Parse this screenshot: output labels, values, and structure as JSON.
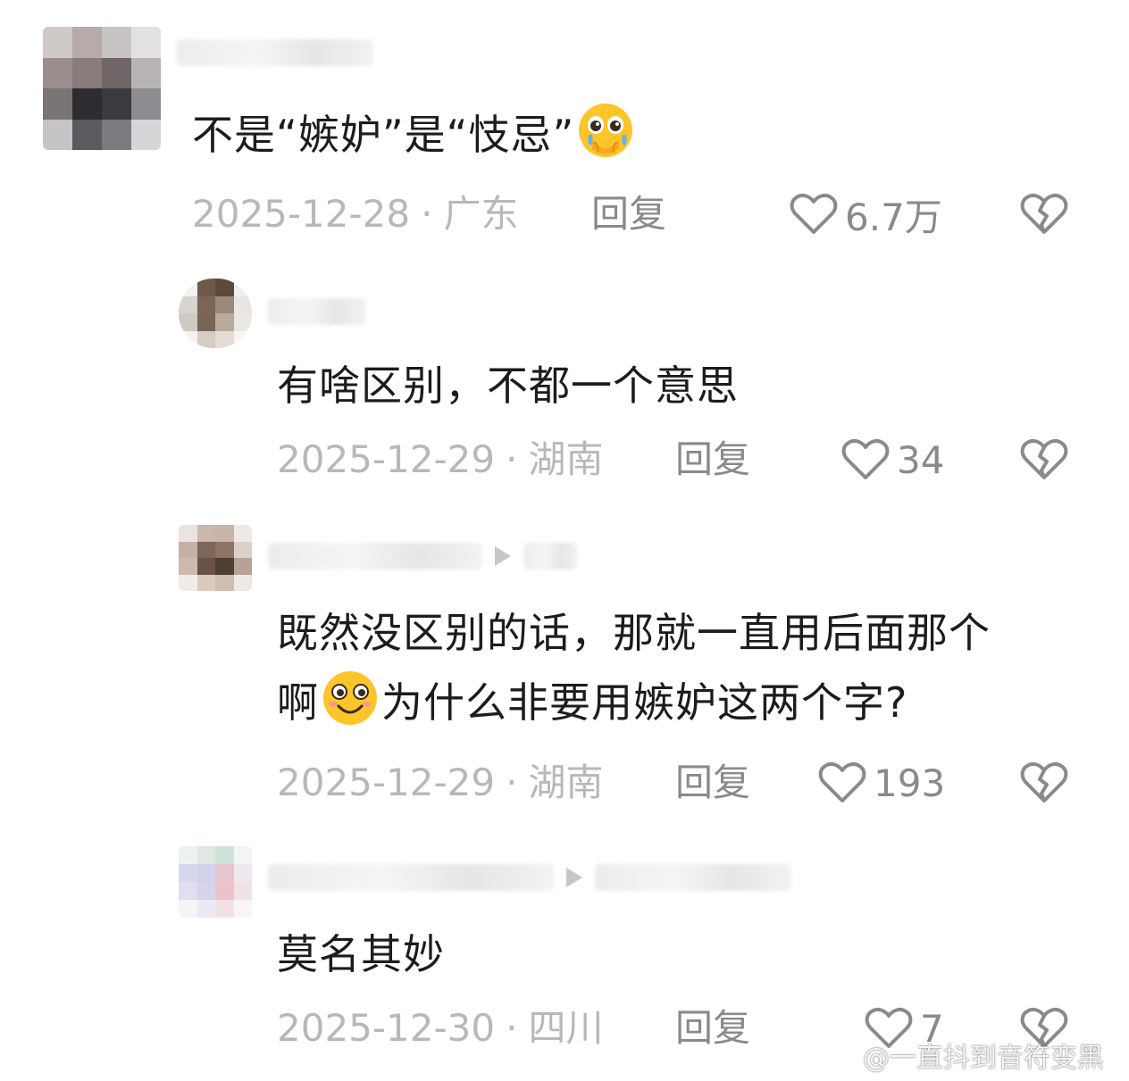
{
  "comments": [
    {
      "text_before": "不是“嫉妒”是“忮忌”",
      "text_after": "",
      "emoji": "pleading-crying-face",
      "date": "2025-12-28",
      "separator": "·",
      "location": "广东",
      "reply_label": "回复",
      "likes": "6.7万"
    },
    {
      "text_before": "有啥区别，不都一个意思",
      "text_after": "",
      "date": "2025-12-29",
      "separator": "·",
      "location": "湖南",
      "reply_label": "回复",
      "likes": "34"
    },
    {
      "text_line1": "既然没区别的话，那就一直用后面那个",
      "text_line2_before": "啊",
      "emoji": "smiling-face",
      "text_line2_after": "为什么非要用嫉妒这两个字?",
      "date": "2025-12-29",
      "separator": "·",
      "location": "湖南",
      "reply_label": "回复",
      "likes": "193"
    },
    {
      "text_before": "莫名其妙",
      "date": "2025-12-30",
      "separator": "·",
      "location": "四川",
      "reply_label": "回复",
      "likes": "7"
    }
  ],
  "icons": {
    "like": "heart-outline-icon",
    "dislike": "broken-heart-outline-icon",
    "reply_pointer": "triangle-right-icon"
  },
  "colors": {
    "text": "#1c1c1c",
    "meta": "#b8b8b8",
    "action": "#8a8a8a"
  },
  "watermark": {
    "text": "@一直抖到音符变黑"
  }
}
